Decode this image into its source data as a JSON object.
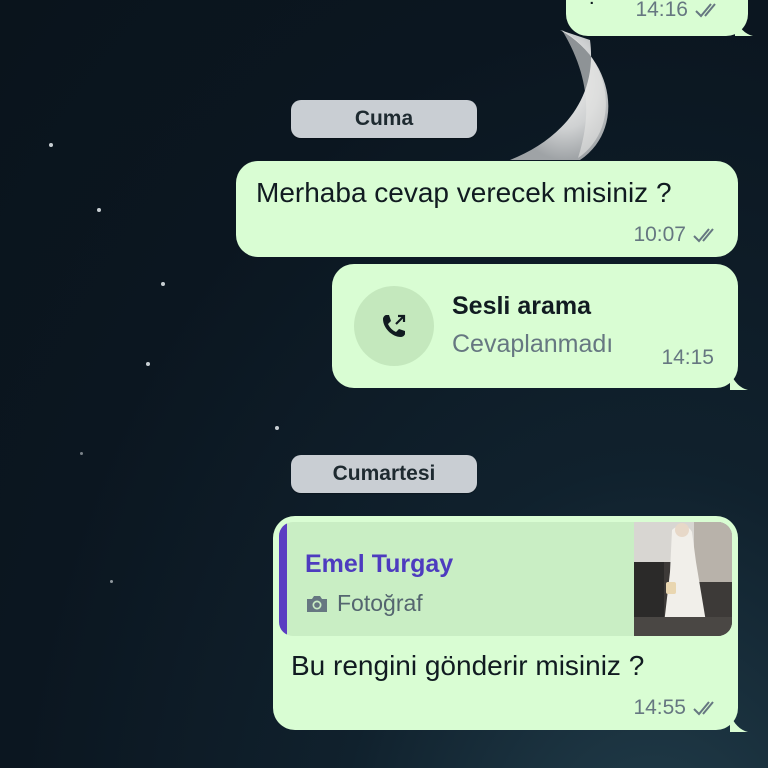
{
  "colors": {
    "outgoing_bubble": "#d9fdd3",
    "date_pill": "#c9ced3",
    "quote_author": "#4d3bbf",
    "quote_bar": "#5b3ec2",
    "meta_text": "#667781",
    "background": "#0b1620"
  },
  "messages": [
    {
      "type": "text",
      "text": "?",
      "time": "14:16",
      "status_icon": "double-check-icon"
    },
    {
      "type": "date",
      "label": "Cuma"
    },
    {
      "type": "text",
      "text": "Merhaba cevap verecek misiniz ?",
      "time": "10:07",
      "status_icon": "double-check-icon"
    },
    {
      "type": "call",
      "icon": "outgoing-call-icon",
      "title": "Sesli arama",
      "subtitle": "Cevaplanmadı",
      "time": "14:15"
    },
    {
      "type": "date",
      "label": "Cumartesi"
    },
    {
      "type": "reply",
      "quote": {
        "author": "Emel Turgay",
        "media_icon": "camera-icon",
        "media_label": "Fotoğraf"
      },
      "text": "Bu rengini gönderir misiniz ?",
      "time": "14:55",
      "status_icon": "double-check-icon"
    }
  ]
}
